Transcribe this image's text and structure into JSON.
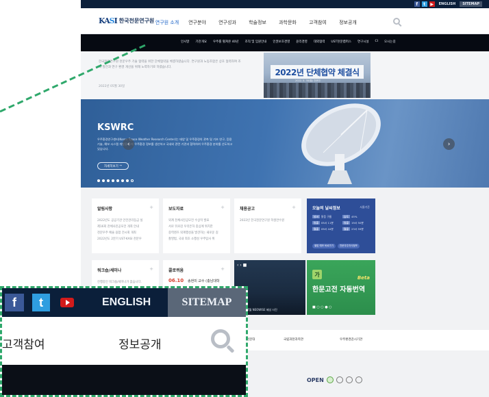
{
  "topbar": {
    "english": "ENGLISH",
    "sitemap": "SITEMAP"
  },
  "logo": {
    "text": "한국천문연구원"
  },
  "gnb": {
    "items": [
      "연구원 소개",
      "연구분야",
      "연구성과",
      "학술정보",
      "과학문화",
      "고객참여",
      "정보공개"
    ]
  },
  "subnav": {
    "items": [
      "인사말",
      "기관개요",
      "우주를 펼쳐온 40년",
      "조직 및 임원안내",
      "인권보호경영",
      "윤리경영",
      "대외협력",
      "UST천문캠퍼스",
      "연구시설",
      "CI",
      "오시는길"
    ]
  },
  "news": {
    "text": "한국천문연구원 천문우주 기술 협력을 위한 단체협약을 체결하였습니다. 연구원과 노동조합은 상호 협력하여 조직 발전과 연구 환경 개선을 위해 노력하기로 하였습니다.",
    "date": "2022년 05월 30일",
    "photo_banner": "2022년 단체협약 체결식",
    "photo_sub": "2022. 5. 30(월) 천문연"
  },
  "hero": {
    "title": "KSWRC",
    "desc": "우주환경연구센터(Korea Space Weather Research Center)는 태양 및 우주환경의 관측 및 기초 연구, 응용 기술, 예보 시스템 개발을 통해 우주환경 정보를 생산하고 국내외 관련 기관과 협력하여 우주환경 분야를 선도하고 있습니다.",
    "more": "자세히보기",
    "slide_count": 8,
    "active_slide": 0
  },
  "cards": {
    "notice": {
      "title": "알림사항",
      "items": [
        "2022년도 공공기관 안전관리등급 실",
        "제16회 천체사진공모전 개최 안내",
        "천문우주 예술 융합 전시회 개최",
        "2022년도 2분기 UST-KASI 천문우"
      ]
    },
    "press": {
      "title": "보도자료",
      "items": [
        "외계 천체사진공모전 수상작 발표",
        "서로 뒤로감 우리은하 중심에 위치한",
        "중력렌즈 외계행성을 발견하는 새로운 길",
        "촬영법, 국내 최초 소행성 우주탐사 위"
      ]
    },
    "recruit": {
      "title": "채용공고",
      "items": [
        "2022년 한국천문연구원 학생연수원"
      ]
    },
    "weather": {
      "title": "오늘의 날씨정보",
      "date": "서울기준",
      "rows": [
        [
          "날씨",
          "맑음 구름",
          "습도",
          "45%"
        ],
        [
          "일출",
          "05시 11분",
          "일몰",
          "19시 50분"
        ],
        [
          "월출",
          "09시 44분",
          "월몰",
          "23시 59분"
        ]
      ],
      "btn1": "별밤 예보 바로가기",
      "btn2": "천문우주지식정보"
    },
    "workshop": {
      "title": "워크숍/세미나",
      "items": [
        "진행중인 워크숍/세미나가 없습니다."
      ]
    },
    "colloquium": {
      "title": "콜로퀴움",
      "date": "06.10",
      "text": "송현미 교수 (충남대학"
    },
    "video": {
      "caption": "2020년 7월 NEOWISE 혜성 사진"
    },
    "translate": {
      "badge": "Beta",
      "title": "한문고전 자동번역"
    }
  },
  "partners": {
    "items": [
      "천문대",
      "국립과천과학관",
      "우주환경감시기관"
    ]
  },
  "footer": {
    "open_label": "OPEN"
  },
  "inset": {
    "english": "ENGLISH",
    "sitemap": "SITEMAP",
    "menu1": "고객참여",
    "menu2": "정보공개"
  }
}
